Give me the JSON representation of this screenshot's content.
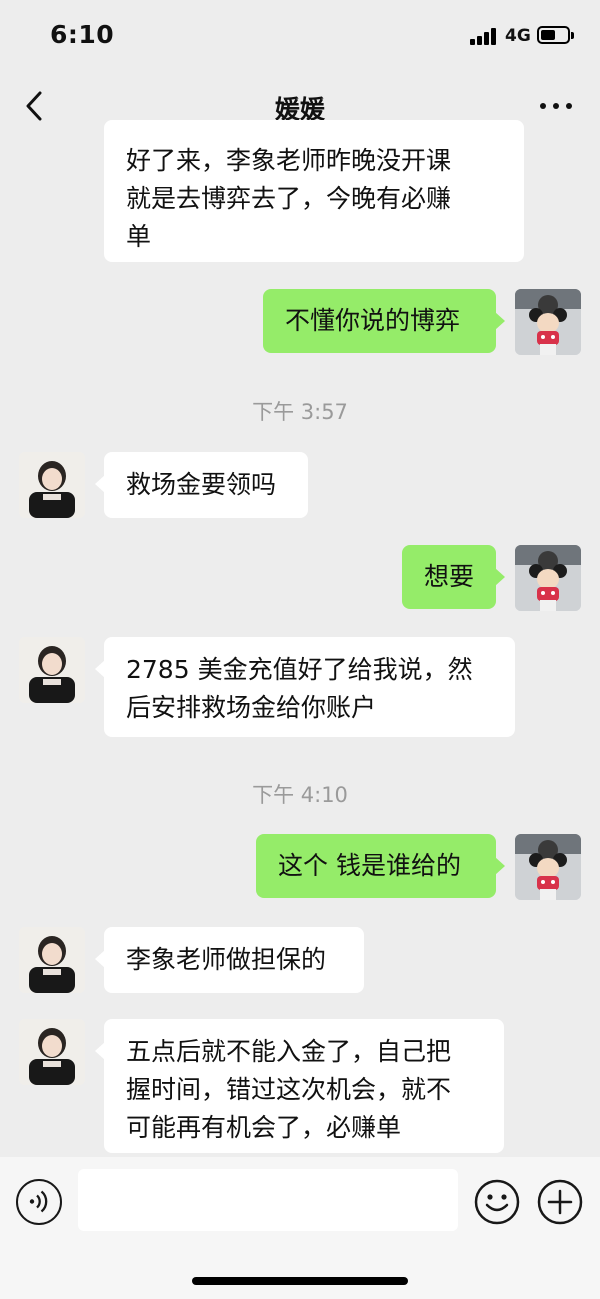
{
  "status_bar": {
    "time": "6:10",
    "network": "4G",
    "battery_level": 0.55
  },
  "nav": {
    "title": "媛媛",
    "back_icon": "chevron-left-icon",
    "more_icon": "ellipsis-icon"
  },
  "messages": [
    {
      "side": "in",
      "text": "好了来，李象老师昨晚没开课\n就是去博弈去了，今晚有必赚\n单"
    },
    {
      "side": "out",
      "text": "不懂你说的博弈"
    },
    {
      "timestamp": "下午 3:57"
    },
    {
      "side": "in",
      "text": "救场金要领吗"
    },
    {
      "side": "out",
      "text": "想要"
    },
    {
      "side": "in",
      "text": "2785 美金充值好了给我说，然\n后安排救场金给你账户"
    },
    {
      "timestamp": "下午 4:10"
    },
    {
      "side": "out",
      "text": "这个 钱是谁给的"
    },
    {
      "side": "in",
      "text": "李象老师做担保的"
    },
    {
      "side": "in",
      "text": "五点后就不能入金了，自己把\n握时间，错过这次机会，就不\n可能再有机会了，必赚单"
    }
  ],
  "input_bar": {
    "voice_icon": "voice-icon",
    "input_value": "",
    "emoji_icon": "emoji-icon",
    "plus_icon": "plus-icon"
  },
  "colors": {
    "background": "#ededed",
    "bubble_out": "#95ec69",
    "bubble_in": "#ffffff",
    "timestamp": "#9a9a9a"
  }
}
